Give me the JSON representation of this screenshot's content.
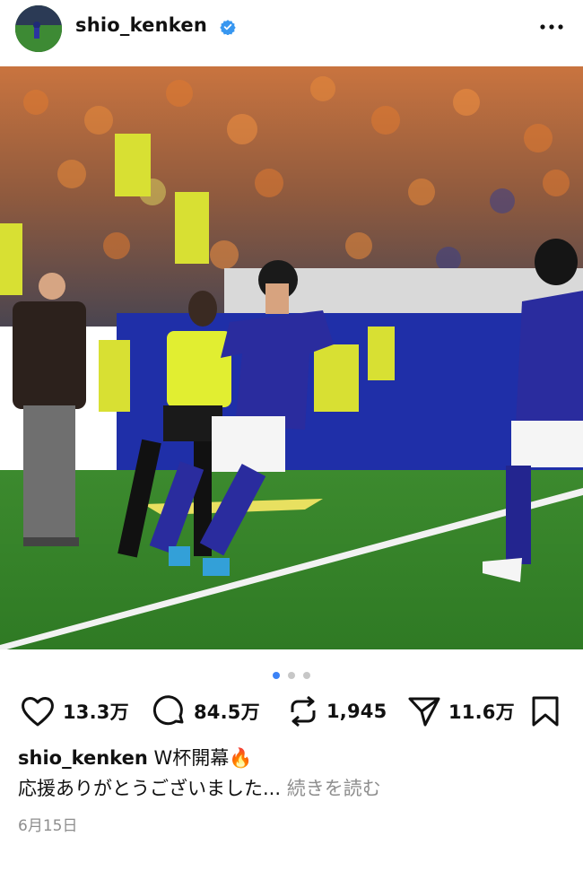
{
  "post": {
    "username": "shio_kenken",
    "verified": true,
    "likes": "13.3万",
    "comments": "84.5万",
    "reposts": "1,945",
    "shares": "11.6万",
    "caption_title": "W杯開幕",
    "caption_emoji": "🔥",
    "caption_line2": "応援ありがとうございました...",
    "more_label": "続きを読む",
    "date": "6月15日",
    "carousel": {
      "count": 3,
      "active": 0
    }
  },
  "colors": {
    "verified": "#3897f0",
    "active_dot": "#3b82f6",
    "pitch": "#3f8f2f",
    "kit_blue": "#2a2c9e"
  },
  "icons": [
    "profile-avatar",
    "verified-badge-icon",
    "more-options-icon",
    "heart-icon",
    "comment-icon",
    "repost-icon",
    "share-icon",
    "bookmark-icon",
    "fire-emoji"
  ]
}
